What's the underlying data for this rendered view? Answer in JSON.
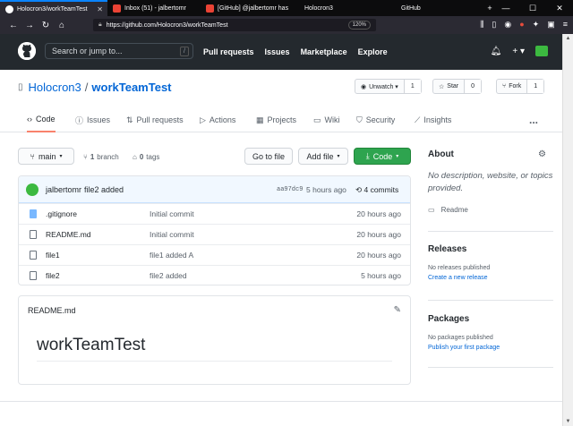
{
  "tabs": [
    {
      "title": "Holocron3/workTeamTest",
      "icon": "github-favicon-icon",
      "active": true
    },
    {
      "title": "Inbox (51) - jalbertomr",
      "icon": "gmail-favicon-icon",
      "active": false
    },
    {
      "title": "[GitHub] @jalbertomr has",
      "icon": "gmail-favicon-icon",
      "active": false
    },
    {
      "title": "Holocron3",
      "icon": "github-favicon-icon",
      "active": false
    },
    {
      "title": "GitHub",
      "icon": "github-favicon-icon",
      "active": false
    }
  ],
  "browser": {
    "url": "https://github.com/Holocron3/workTeamTest",
    "zoom": "120%"
  },
  "header": {
    "search_placeholder": "Search or jump to...",
    "slash_key": "/",
    "nav": [
      "Pull requests",
      "Issues",
      "Marketplace",
      "Explore"
    ],
    "plus": "+ ▾"
  },
  "repo": {
    "owner": "Holocron3",
    "separator": "/",
    "name": "workTeamTest",
    "unwatch_label": "Unwatch ▾",
    "watch_count": "1",
    "star_label": "Star",
    "star_count": "0",
    "fork_label": "Fork",
    "fork_count": "1"
  },
  "repo_tabs": [
    "Code",
    "Issues",
    "Pull requests",
    "Actions",
    "Projects",
    "Wiki",
    "Security",
    "Insights",
    "..."
  ],
  "branchbar": {
    "branch": "main",
    "branch_count_num": "1",
    "branch_count_word": "branch",
    "tag_count_num": "0",
    "tag_count_word": "tags",
    "go_to_file": "Go to file",
    "add_file": "Add file",
    "code": "Code"
  },
  "commit": {
    "author": "jalbertomr",
    "message": "file2 added",
    "sha": "aa97dc9",
    "time": "5 hours ago",
    "count": "4 commits"
  },
  "files": [
    {
      "name": ".gitignore",
      "message": "Initial commit",
      "age": "20 hours ago"
    },
    {
      "name": "README.md",
      "message": "Initial commit",
      "age": "20 hours ago"
    },
    {
      "name": "file1",
      "message": "file1 added A",
      "age": "20 hours ago"
    },
    {
      "name": "file2",
      "message": "file2 added",
      "age": "5 hours ago"
    }
  ],
  "readme": {
    "filename": "README.md",
    "heading": "workTeamTest"
  },
  "sidebar": {
    "about_title": "About",
    "about_text": "No description, website, or topics provided.",
    "readme_link": "Readme",
    "releases_title": "Releases",
    "releases_text": "No releases published",
    "releases_link": "Create a new release",
    "packages_title": "Packages",
    "packages_text": "No packages published",
    "packages_link": "Publish your first package"
  },
  "colors": {
    "accent": "#0366d6",
    "header_bg": "#24292e",
    "code_button": "#2ea44f",
    "tab_underline": "#f9826c"
  }
}
